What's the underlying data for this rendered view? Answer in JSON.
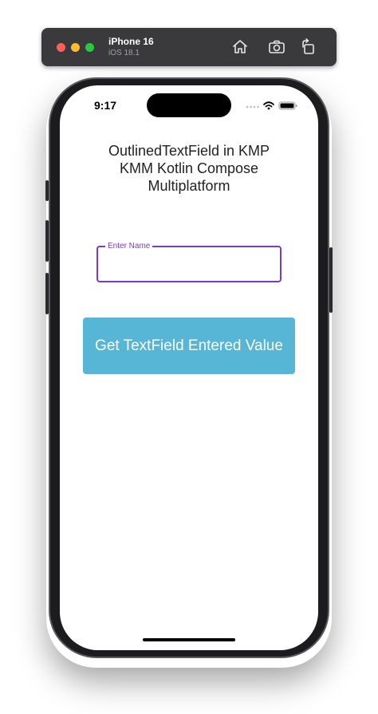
{
  "simulator": {
    "device_name": "iPhone 16",
    "os_version": "iOS 18.1",
    "toolbar_icons": [
      "home-icon",
      "screenshot-icon",
      "rotate-icon"
    ]
  },
  "status_bar": {
    "time": "9:17",
    "icons": [
      "signal-icon",
      "wifi-icon",
      "battery-icon"
    ]
  },
  "screen": {
    "title_lines": [
      "OutlinedTextField in KMP",
      "KMM Kotlin Compose",
      "Multiplatform"
    ],
    "text_field": {
      "label": "Enter Name",
      "value": "",
      "accent_color": "#7c3acd"
    },
    "button": {
      "label": "Get TextField Entered Value",
      "color": "#57b6d6"
    }
  }
}
